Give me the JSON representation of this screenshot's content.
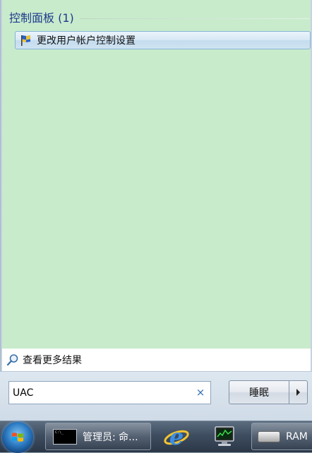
{
  "results": {
    "group_title": "控制面板 (1)",
    "items": [
      {
        "label": "更改用户帐户控制设置",
        "icon": "uac-flag-icon"
      }
    ]
  },
  "see_more": {
    "label": "查看更多结果",
    "icon": "search-icon"
  },
  "search": {
    "value": "UAC",
    "clear_icon": "×"
  },
  "power": {
    "label": "睡眠",
    "arrow_icon": "chevron-right-icon"
  },
  "taskbar": {
    "start_icon": "windows-orb-icon",
    "items": [
      {
        "label": "管理员: 命...",
        "icon": "cmd-icon"
      },
      {
        "label": "",
        "icon": "internet-explorer-icon"
      },
      {
        "label": "",
        "icon": "resource-monitor-icon"
      },
      {
        "label": "RAM",
        "icon": "drive-icon"
      }
    ]
  },
  "colors": {
    "results_bg": "#c8ebcc",
    "group_title": "#1e3a8c",
    "highlight_border": "#86b5d6"
  }
}
